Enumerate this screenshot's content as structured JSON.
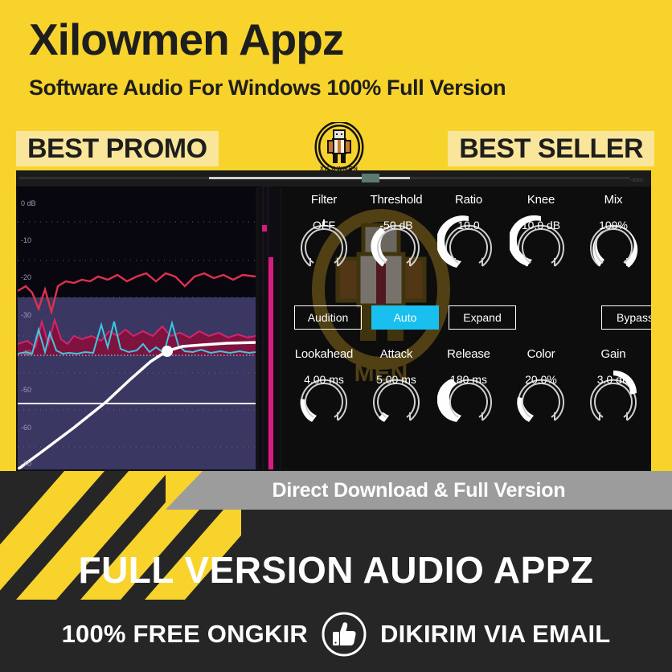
{
  "header": {
    "title": "Xilowmen Appz",
    "subtitle": "Software Audio For Windows 100% Full Version",
    "logo_word": "XILOWMEN",
    "ribbon_left": "BEST PROMO",
    "ribbon_right": "BEST SELLER"
  },
  "plugin": {
    "toolbar_label": "-60m",
    "graph": {
      "y_labels": [
        "0 dB",
        "-10",
        "-20",
        "-30",
        "-40",
        "-50",
        "-60",
        "-70"
      ],
      "threshold_line_db": -50,
      "curve_node_label": ""
    },
    "knobs_top": [
      {
        "label": "Filter",
        "value": "OFF",
        "pct": 0.0
      },
      {
        "label": "Threshold",
        "value": "-50 dB",
        "pct": 0.62
      },
      {
        "label": "Ratio",
        "value": "10.0",
        "pct": 0.78
      },
      {
        "label": "Knee",
        "value": "10.0 dB",
        "pct": 0.7
      },
      {
        "label": "Mix",
        "value": "100%",
        "pct": 1.0
      }
    ],
    "buttons": [
      {
        "label": "Audition",
        "active": false
      },
      {
        "label": "Auto",
        "active": true
      },
      {
        "label": "Expand",
        "active": false
      },
      {
        "label": "Bypass",
        "active": false
      }
    ],
    "knobs_bottom": [
      {
        "label": "Lookahead",
        "value": "4.00 ms",
        "pct": 0.18
      },
      {
        "label": "Attack",
        "value": "5.00 ms",
        "pct": 0.1
      },
      {
        "label": "Release",
        "value": "180 ms",
        "pct": 0.42
      },
      {
        "label": "Color",
        "value": "20.0%",
        "pct": 0.2
      },
      {
        "label": "Gain",
        "value": "3.0 dB",
        "pct": 0.96
      }
    ],
    "colors": {
      "accent_active": "#18BFEF",
      "meter": "#D81B7E",
      "panel_bg": "#0D0D0D",
      "graph_bg": "#0a0910"
    }
  },
  "footer": {
    "gray_band": "Direct Download & Full Version",
    "headline": "FULL VERSION AUDIO APPZ",
    "left_text": "100% FREE ONGKIR",
    "right_text": "DIKIRIM VIA EMAIL",
    "icon": "thumbs-up-icon"
  },
  "theme": {
    "yellow": "#F8D32C",
    "cream": "#FAE69A",
    "dark": "#262626",
    "gray": "#9C9C9C"
  }
}
